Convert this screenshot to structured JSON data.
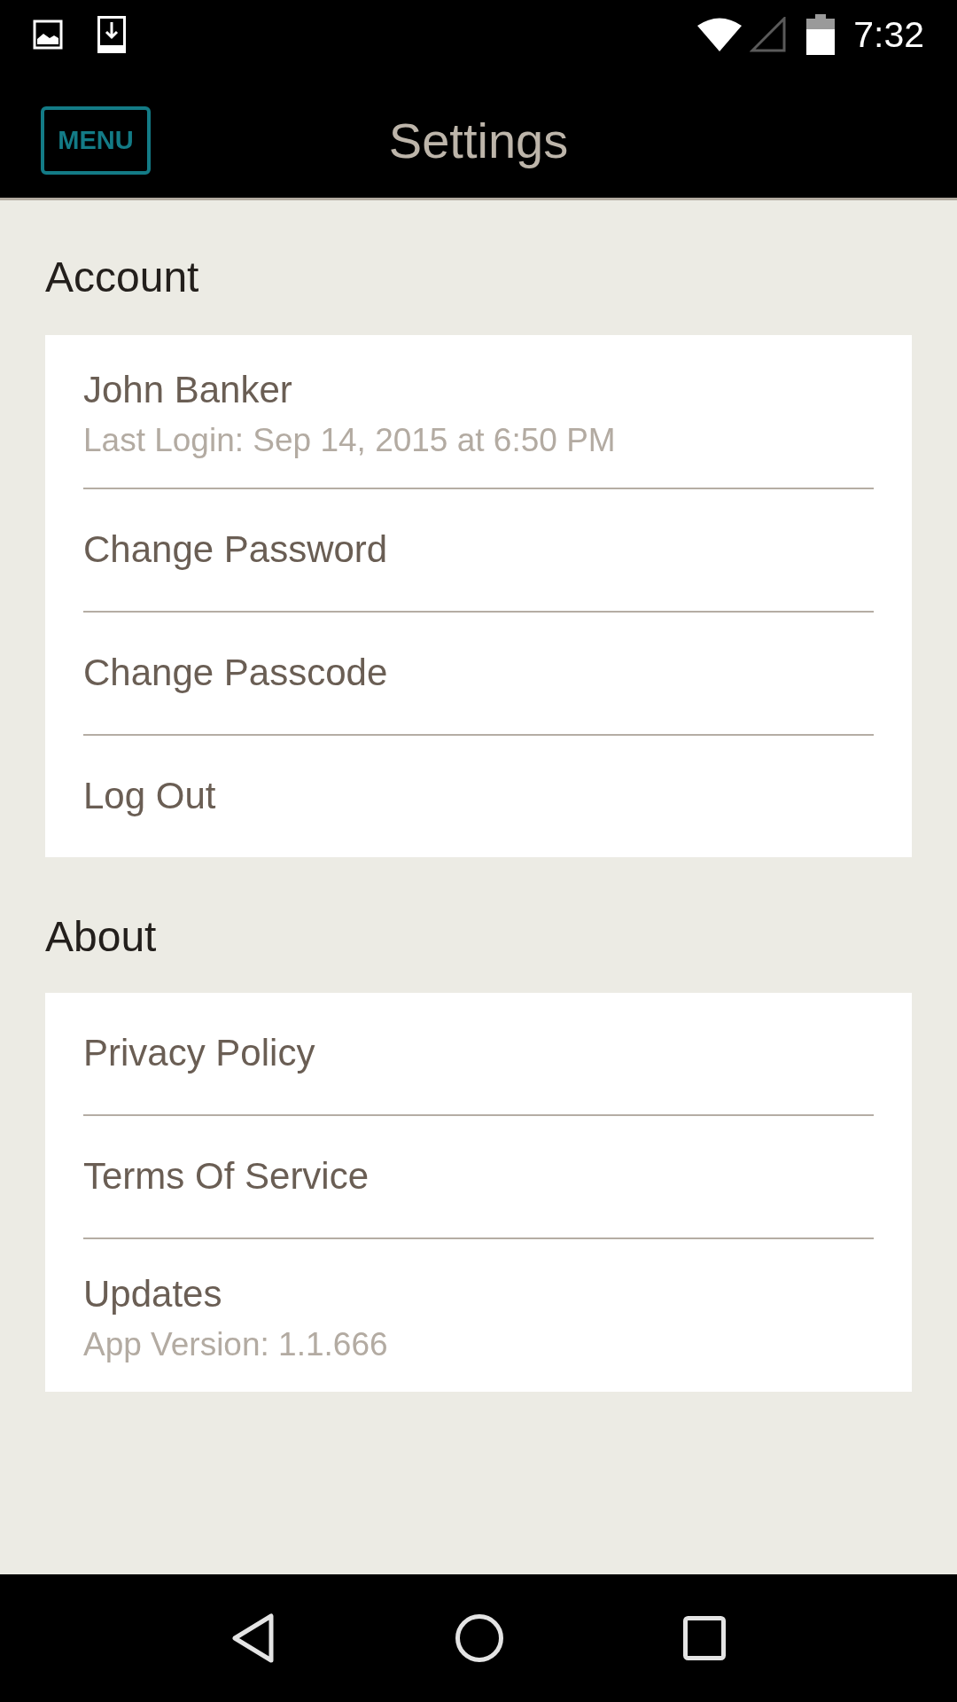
{
  "status_bar": {
    "time": "7:32"
  },
  "app_bar": {
    "menu_button": "MENU",
    "title": "Settings"
  },
  "sections": [
    {
      "heading": "Account",
      "items": [
        {
          "title": "John Banker",
          "subtitle": "Last Login: Sep 14, 2015 at 6:50 PM"
        },
        {
          "title": "Change Password"
        },
        {
          "title": "Change Passcode"
        },
        {
          "title": "Log Out"
        }
      ]
    },
    {
      "heading": "About",
      "items": [
        {
          "title": "Privacy Policy"
        },
        {
          "title": "Terms Of Service"
        },
        {
          "title": "Updates",
          "subtitle": "App Version: 1.1.666"
        }
      ]
    }
  ]
}
